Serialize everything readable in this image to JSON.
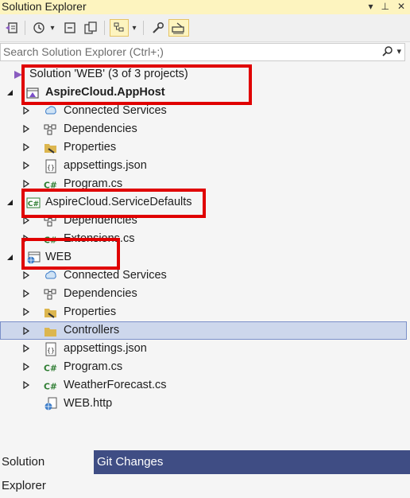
{
  "window": {
    "title": "Solution Explorer",
    "title_icons": [
      "dropdown-arrow-icon",
      "pin-icon",
      "close-icon"
    ]
  },
  "toolbar": {
    "buttons": [
      "switch-views-icon",
      "history-icon",
      "collapse-all-icon",
      "show-all-files-icon",
      "sync-icon",
      "properties-icon",
      "preview-selected-icon"
    ]
  },
  "search": {
    "placeholder": "Search Solution Explorer (Ctrl+;)"
  },
  "tree": {
    "solution": "Solution 'WEB' (3 of 3 projects)",
    "apphost": {
      "name": "AspireCloud.AppHost",
      "children": [
        "Connected Services",
        "Dependencies",
        "Properties",
        "appsettings.json",
        "Program.cs"
      ]
    },
    "servicedefaults": {
      "name": "AspireCloud.ServiceDefaults",
      "children": [
        "Dependencies",
        "Extensions.cs"
      ]
    },
    "web": {
      "name": "WEB",
      "children": [
        "Connected Services",
        "Dependencies",
        "Properties",
        "Controllers",
        "appsettings.json",
        "Program.cs",
        "WeatherForecast.cs",
        "WEB.http"
      ]
    }
  },
  "tabs": {
    "solution_explorer": "Solution Explorer",
    "git_changes": "Git Changes"
  },
  "colors": {
    "highlight_border": "#e00000",
    "selection_bg": "#cdd7ec",
    "tab_bar": "#3f4d84",
    "title_bar": "#fdf4bf"
  }
}
